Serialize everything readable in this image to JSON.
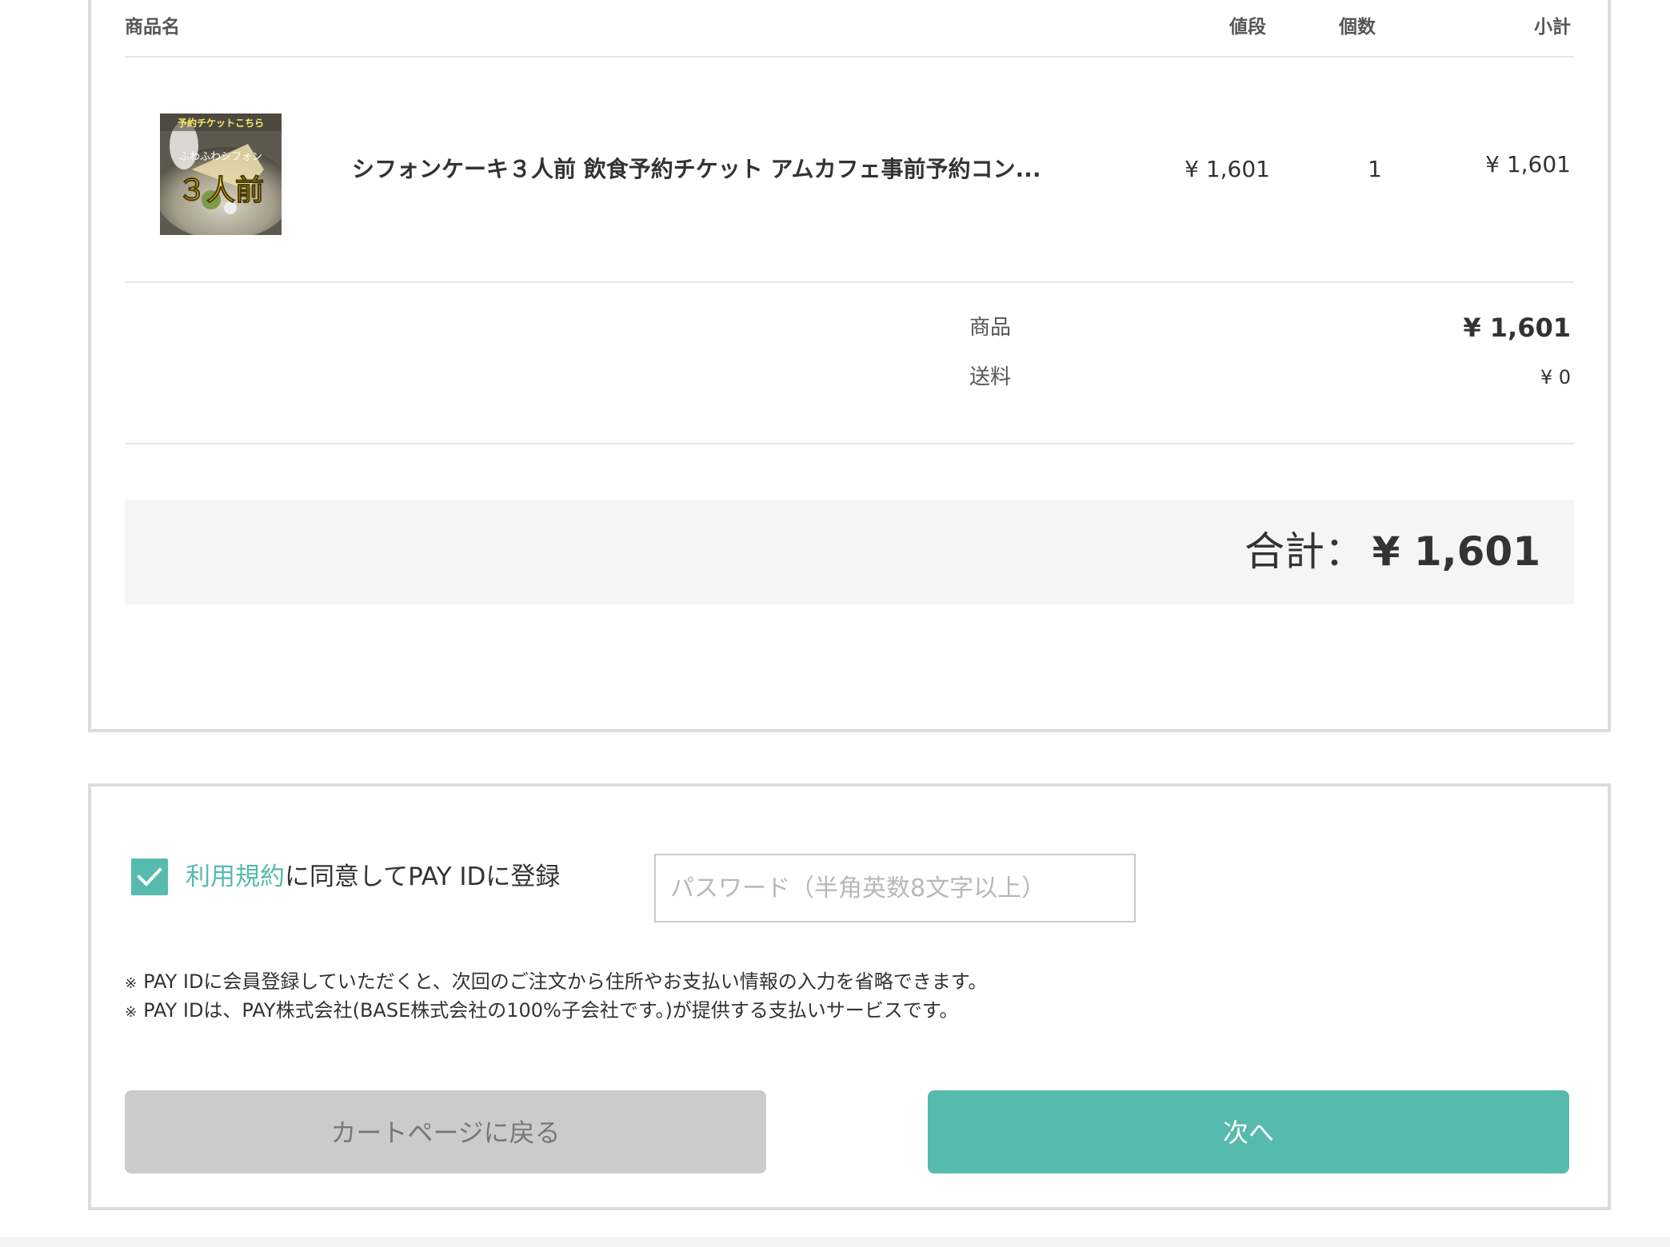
{
  "table": {
    "headers": {
      "name": "商品名",
      "price": "値段",
      "qty": "個数",
      "subtotal": "小計"
    },
    "items": [
      {
        "name": "シフォンケーキ３人前 飲食予約チケット アムカフェ事前予約コン...",
        "price": "¥ 1,601",
        "qty": "1",
        "subtotal": "¥ 1,601",
        "thumbnail": {
          "banner_text": "予約チケットこちら",
          "sub_text": "ふわふわシフォン",
          "main_text": "３人前"
        }
      }
    ]
  },
  "summary": {
    "products_label": "商品",
    "products_value": "¥ 1,601",
    "shipping_label": "送料",
    "shipping_value": "¥ 0"
  },
  "total": {
    "label": "合計：",
    "value": "¥ 1,601"
  },
  "payid": {
    "checkbox_checked": true,
    "terms_link": "利用規約",
    "agree_text": "に同意してPAY IDに登録",
    "password_placeholder": "パスワード（半角英数8文字以上）",
    "note_mark": "※",
    "notes": [
      "PAY IDに会員登録していただくと、次回のご注文から住所やお支払い情報の入力を省略できます。",
      "PAY IDは、PAY株式会社(BASE株式会社の100%子会社です。)が提供する支払いサービスです。"
    ]
  },
  "buttons": {
    "back": "カートページに戻る",
    "next": "次へ"
  },
  "colors": {
    "accent": "#56bbad",
    "back_button": "#cbcbcb",
    "total_background": "#f5f5f5",
    "card_border": "#dcdcdc"
  }
}
